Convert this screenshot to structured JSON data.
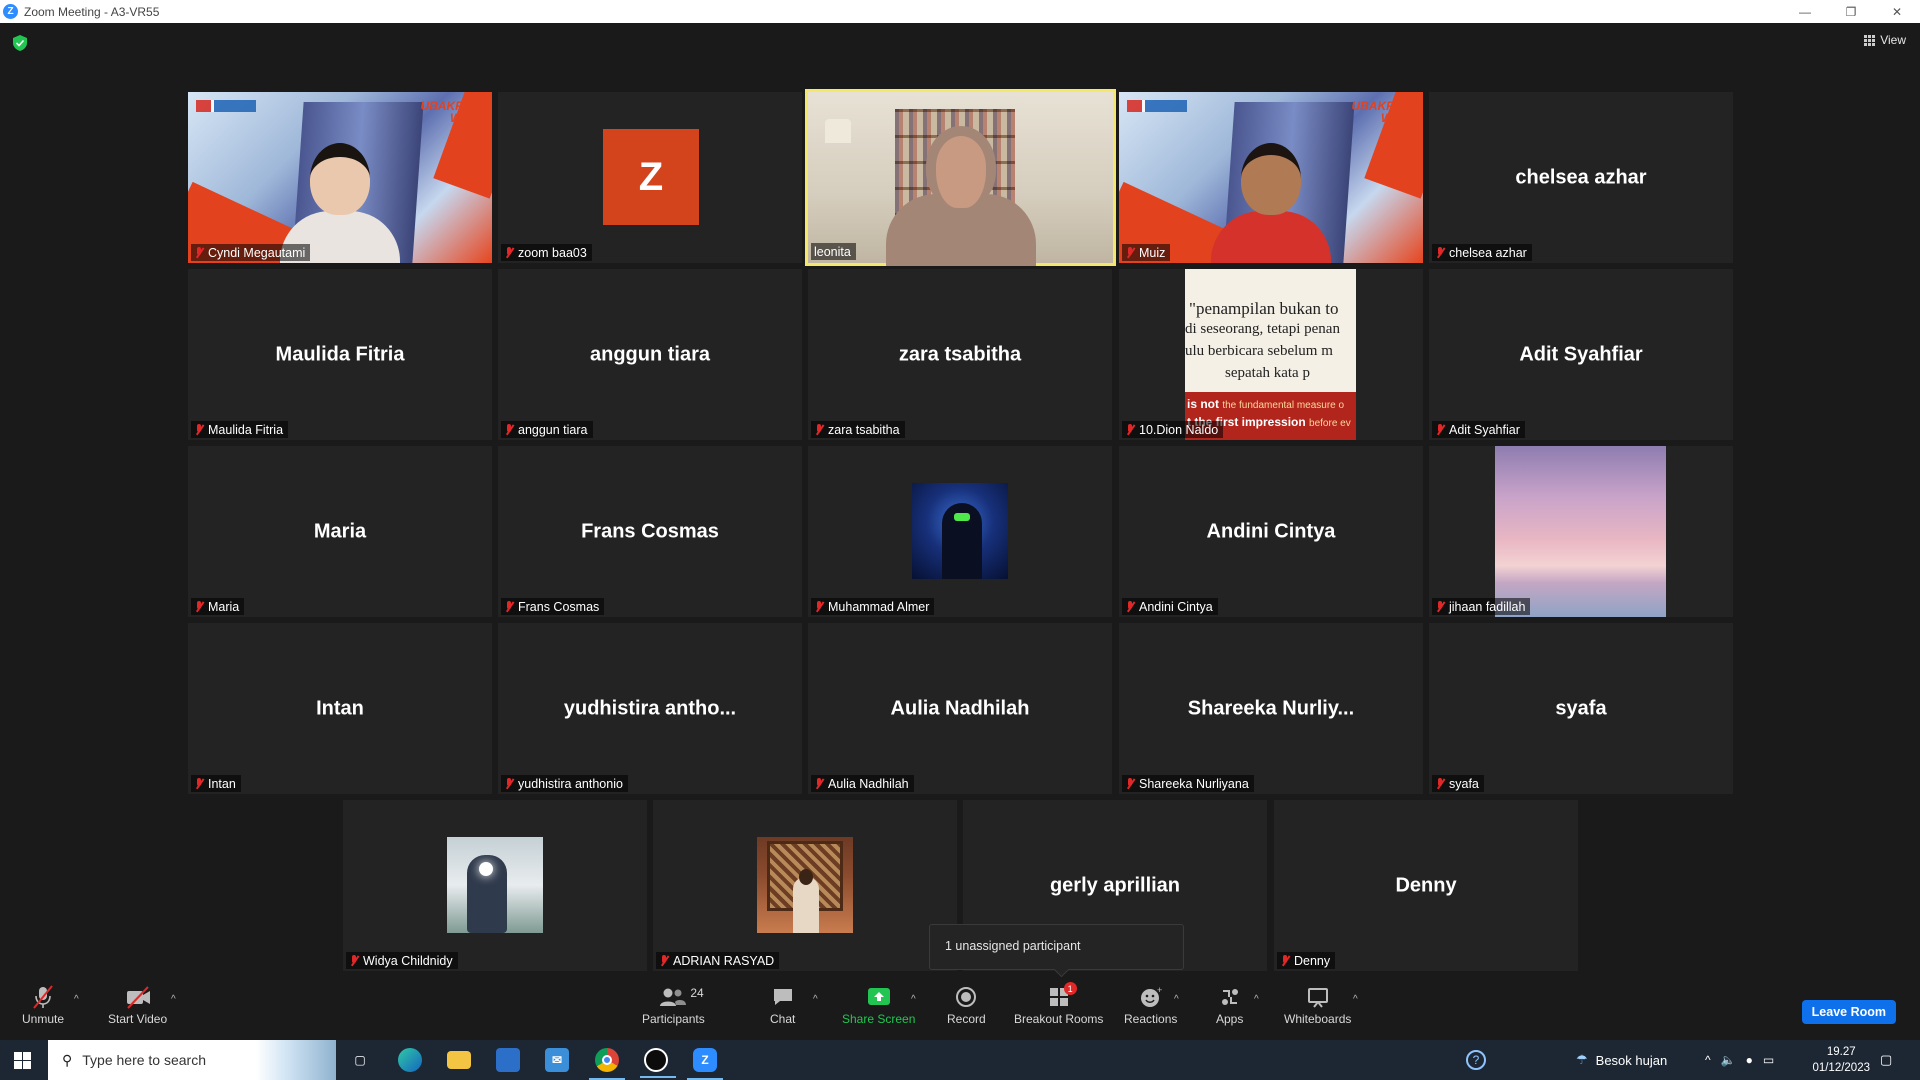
{
  "window": {
    "title": "Zoom Meeting - A3-VR55",
    "logo_letter": "Z",
    "controls": [
      "—",
      "❐",
      "✕"
    ]
  },
  "meeting": {
    "view_label": "View",
    "tiles": [
      {
        "id": "cyndi",
        "label": "Cyndi Megautami",
        "type": "video-event"
      },
      {
        "id": "zoom",
        "label": "zoom baa03",
        "type": "avatar",
        "avatar_letter": "Z"
      },
      {
        "id": "leonita",
        "label": "leonita",
        "type": "video-room",
        "active": true
      },
      {
        "id": "muiz",
        "label": "Muiz",
        "type": "video-event"
      },
      {
        "id": "chelsea",
        "label": "chelsea azhar",
        "display": "chelsea azhar",
        "type": "name"
      },
      {
        "id": "maulida",
        "label": "Maulida Fitria",
        "display": "Maulida Fitria",
        "type": "name"
      },
      {
        "id": "anggun",
        "label": "anggun tiara",
        "display": "anggun tiara",
        "type": "name"
      },
      {
        "id": "zara",
        "label": "zara tsabitha",
        "display": "zara tsabitha",
        "type": "name"
      },
      {
        "id": "dion",
        "label": "10.Dion Naldo",
        "type": "quote"
      },
      {
        "id": "adit",
        "label": "Adit Syahfiar",
        "display": "Adit Syahfiar",
        "type": "name"
      },
      {
        "id": "maria",
        "label": "Maria",
        "display": "Maria",
        "type": "name"
      },
      {
        "id": "frans",
        "label": "Frans Cosmas",
        "display": "Frans Cosmas",
        "type": "name"
      },
      {
        "id": "almer",
        "label": "Muhammad Almer",
        "type": "thumb-blue"
      },
      {
        "id": "andini",
        "label": "Andini Cintya",
        "display": "Andini Cintya",
        "type": "name"
      },
      {
        "id": "jihaan",
        "label": "jihaan fadillah",
        "type": "sky"
      },
      {
        "id": "intan",
        "label": "Intan",
        "display": "Intan",
        "type": "name"
      },
      {
        "id": "yudhistira",
        "label": "yudhistira anthonio",
        "display": "yudhistira  antho...",
        "type": "name"
      },
      {
        "id": "aulia",
        "label": "Aulia Nadhilah",
        "display": "Aulia Nadhilah",
        "type": "name"
      },
      {
        "id": "shareeka",
        "label": "Shareeka Nurliyana",
        "display": "Shareeka  Nurliy...",
        "type": "name"
      },
      {
        "id": "syafa",
        "label": "syafa",
        "display": "syafa",
        "type": "name"
      },
      {
        "id": "widya",
        "label": "Widya Childnidy",
        "type": "thumb-photo"
      },
      {
        "id": "adrian",
        "label": "ADRIAN RASYAD",
        "type": "thumb-portrait"
      },
      {
        "id": "gerly",
        "label": "",
        "display": "gerly aprillian",
        "type": "name"
      },
      {
        "id": "denny",
        "label": "Denny",
        "display": "Denny",
        "type": "name"
      }
    ],
    "event_brand": "UBAKRIE'S WEEK",
    "quote": {
      "lines": [
        "\"penampilan bukan to",
        "di seseorang, tetapi penan",
        "ulu berbicara sebelum m",
        "sepatah kata p"
      ],
      "red_line1_bold": "is not",
      "red_line1_rest": "the fundamental measure o",
      "red_line2_bold": "t the first impression",
      "red_line2_rest": "before ev"
    },
    "tooltip": "1 unassigned participant"
  },
  "toolbar": {
    "unmute": "Unmute",
    "start_video": "Start Video",
    "participants": "Participants",
    "participants_count": "24",
    "chat": "Chat",
    "share_screen": "Share Screen",
    "record": "Record",
    "breakout_rooms": "Breakout Rooms",
    "breakout_badge": "1",
    "reactions": "Reactions",
    "apps": "Apps",
    "whiteboards": "Whiteboards",
    "leave_room": "Leave Room"
  },
  "taskbar": {
    "search_placeholder": "Type here to search",
    "weather": "Besok hujan",
    "time": "19.27",
    "date": "01/12/2023"
  },
  "colors": {
    "accent_blue": "#0e71eb",
    "share_green": "#23c552",
    "mute_red": "#e02828",
    "active_speaker": "#f3e86c",
    "tile_bg": "#232323"
  }
}
